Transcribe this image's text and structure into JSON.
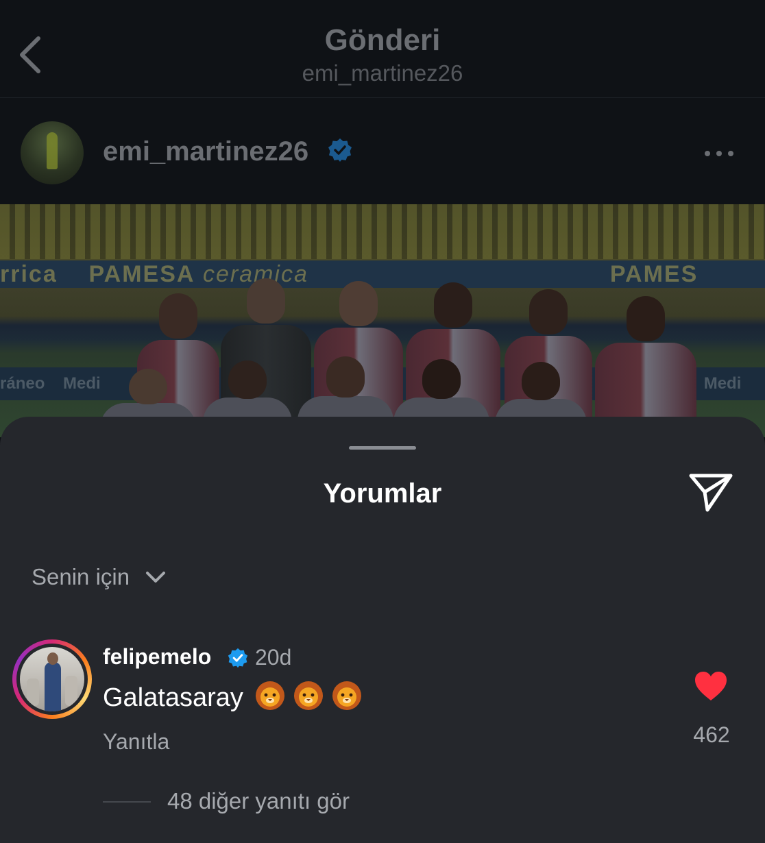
{
  "topbar": {
    "title": "Gönderi",
    "subtitle": "emi_martinez26"
  },
  "post": {
    "username": "emi_martinez26",
    "verified": true,
    "photo_ad_texts": [
      "rrica",
      "PAMESA",
      "ceramica",
      "PAMES",
      "ráneo",
      "Medi",
      "Medi"
    ]
  },
  "comments_sheet": {
    "title": "Yorumlar",
    "filter_label": "Senin için",
    "comment": {
      "username": "felipemelo",
      "verified": true,
      "time": "20d",
      "text": "Galatasaray",
      "emojis": [
        "lion-face",
        "lion-face",
        "lion-face"
      ],
      "reply_label": "Yanıtla",
      "like_count": "462",
      "liked": true,
      "view_replies_label": "48 diğer yanıtı gör"
    }
  },
  "colors": {
    "background": "#0d1014",
    "sheet": "#25272c",
    "verified": "#1d9bf0",
    "like": "#ff3040",
    "muted_text": "#a6a9ae"
  }
}
